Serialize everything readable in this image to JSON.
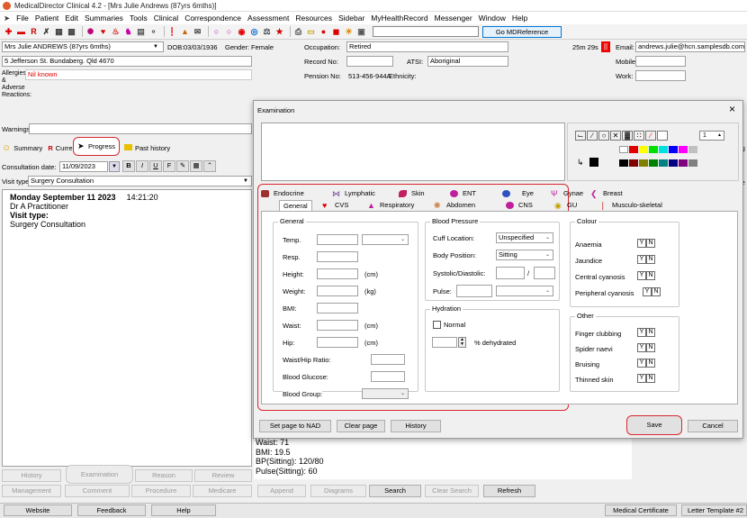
{
  "window": {
    "title": "MedicalDirector Clinical 4.2 - [Mrs Julie Andrews (87yrs 6mths)]"
  },
  "menu": [
    "File",
    "Patient",
    "Edit",
    "Summaries",
    "Tools",
    "Clinical",
    "Correspondence",
    "Assessment",
    "Resources",
    "Sidebar",
    "MyHealthRecord",
    "Messenger",
    "Window",
    "Help"
  ],
  "toolbar": {
    "go_label": "Go MDReference"
  },
  "patient": {
    "name": "Mrs Julie ANDREWS (87yrs 6mths)",
    "dob_label": "DOB:",
    "dob": "03/03/1936",
    "gender_label": "Gender:",
    "gender": "Female",
    "address": "5 Jefferson St. Bundaberg. Qld 4670",
    "occupation_label": "Occupation:",
    "occupation": "Retired",
    "record_label": "Record No:",
    "atsi_label": "ATSI:",
    "atsi": "Aboriginal",
    "pension_label": "Pension No:",
    "pension": "513-456-944A",
    "ethnicity_label": "Ethnicity:",
    "timer": "25m 29s",
    "email_label": "Email:",
    "email": "andrews.julie@hcn.samplesdb.com",
    "mobile_label": "Mobile:",
    "work_label": "Work:",
    "allergies_label": "Allergies & Adverse Reactions:",
    "allergies": "Nil known",
    "warnings_label": "Warnings:"
  },
  "nav_tabs": {
    "summary": "Summary",
    "current": "Current R",
    "progress": "Progress",
    "past": "Past history"
  },
  "consult": {
    "date_label": "Consultation date:",
    "date": "11/09/2023",
    "visit_label": "Visit type:",
    "visit_type": "Surgery Consultation",
    "note_date": "Monday September 11 2023",
    "note_time": "14:21:20",
    "practitioner": "Dr A Practitioner",
    "visit_heading": "Visit type:",
    "visit_value": "Surgery Consultation"
  },
  "lower_notes": [
    "Waist: 71",
    "BMI: 19.5",
    "BP(Sitting): 120/80",
    "Pulse(Sitting): 60"
  ],
  "left_buttons_row1": [
    "History",
    "Examination",
    "Reason",
    "Review"
  ],
  "left_buttons_row2": [
    "Management",
    "Comment",
    "Procedure",
    "Medicare"
  ],
  "bottom_buttons": [
    "Append",
    "Diagrams",
    "Search",
    "Clear Search",
    "Refresh"
  ],
  "status_buttons": [
    "Website",
    "Feedback",
    "Help"
  ],
  "status_right": [
    "Medical Certificate",
    "Letter Template #2"
  ],
  "right_edge": [
    "ng",
    "Me"
  ],
  "dialog": {
    "title": "Examination",
    "close": "×",
    "spin_value": "1",
    "tabs_top": [
      "Endocrine",
      "Lymphatic",
      "Skin",
      "ENT",
      "Eye",
      "Gynae",
      "Breast"
    ],
    "tabs_bottom": [
      "General",
      "CVS",
      "Respiratory",
      "Abdomen",
      "CNS",
      "GU",
      "Musculo-skeletal"
    ],
    "general": {
      "group": "General",
      "temp": "Temp.",
      "resp": "Resp.",
      "height": "Height:",
      "height_unit": "(cm)",
      "weight": "Weight:",
      "weight_unit": "(kg)",
      "bmi": "BMI:",
      "waist": "Waist:",
      "waist_unit": "(cm)",
      "hip": "Hip:",
      "hip_unit": "(cm)",
      "whr": "Waist/Hip Ratio:",
      "glucose": "Blood Glucose:",
      "blood_group": "Blood Group:"
    },
    "bp": {
      "group": "Blood Pressure",
      "cuff_label": "Cuff Location:",
      "cuff": "Unspecified",
      "position_label": "Body Position:",
      "position": "Sitting",
      "sysdia_label": "Systolic/Diastolic:",
      "slash": "/",
      "pulse_label": "Pulse:"
    },
    "hydration": {
      "group": "Hydration",
      "normal": "Normal",
      "dehydrated": "% dehydrated"
    },
    "colour": {
      "group": "Colour",
      "items": [
        "Anaemia",
        "Jaundice",
        "Central cyanosis",
        "Peripheral cyanosis"
      ]
    },
    "other": {
      "group": "Other",
      "items": [
        "Finger clubbing",
        "Spider naevi",
        "Bruising",
        "Thinned skin"
      ]
    },
    "yes": "Y",
    "no": "N",
    "buttons": {
      "nad": "Set page to NAD",
      "clear": "Clear page",
      "history": "History",
      "save": "Save",
      "cancel": "Cancel"
    }
  },
  "colors": {
    "highlight": "#d9282f",
    "accent": "#0078d7"
  }
}
